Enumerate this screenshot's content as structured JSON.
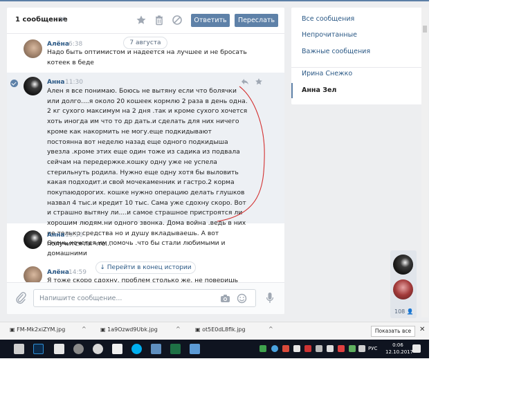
{
  "chat": {
    "header": {
      "selected_count": "1 сообщение",
      "reply_label": "Ответить",
      "forward_label": "Переслать"
    },
    "date_pill": "7 августа",
    "jump_label": "Перейти в конец истории",
    "messages": [
      {
        "author": "Алёна",
        "time": "6:38",
        "text": "Надо быть оптимистом и надеется на лучшее и не бросать котеек в беде"
      },
      {
        "author": "Анна",
        "time": "11:30",
        "text": "Ален я все понимаю. Боюсь не вытяну если что болячки или долго....я около 20 кошеек кормлю 2 раза в день одна. 2 кг сухого максимум на 2 дня .так и кроме сухого хочется хоть иногда им что то др дать.и сделать для них ничего кроме как накормить не могу.еще подкидывают постоянна вот неделю назад еще одного подкидыша увезла .кроме этих еще один тоже из садика из подвала сейчам на передержке.кошку одну уже не успела стерильнуть родила. Нужно еще одну хотя бы выловить какая подходит.и свой мочекаменник и гастро.2 корма покупаюдорогих. кошке нужно операцию делать глушков назвал 4 тыс.и кредит 10 тыс. Сама уже сдохну скоро. Вот и страшно вытяну ли....и самое страшное пристроятся ли хорошим людям.ни одного звонка. Дома война .ведь в них не только средства но и душу вкладываешь. А вот получится ли что..."
      },
      {
        "author": "Анна",
        "time": "13:16",
        "text": "Очень хочется им помочь .что бы стали любимыми и домашними"
      },
      {
        "author": "Алёна",
        "time": "14:59",
        "text": "Я тоже скоро сдохну, проблем столько же, не поверишь"
      }
    ],
    "input_placeholder": "Напишите сообщение..."
  },
  "menu": {
    "items": [
      "Все сообщения",
      "Непрочитанные",
      "Важные сообщения"
    ],
    "contacts": [
      "Ирина Снежко",
      "Анна Зел"
    ]
  },
  "online_count": "108",
  "downloads": {
    "files": [
      "FM-Mk2xiZYM.jpg",
      "1a9Ozwd9Ubk.jpg",
      "ot5E0dL8flk.jpg"
    ],
    "show_all": "Показать все"
  },
  "taskbar": {
    "lang": "РУС",
    "time": "0:06",
    "date": "12.10.2017"
  },
  "colors": {
    "accent": "#5e81a8",
    "link": "#2a5885",
    "annotation": "#d32f2f"
  }
}
